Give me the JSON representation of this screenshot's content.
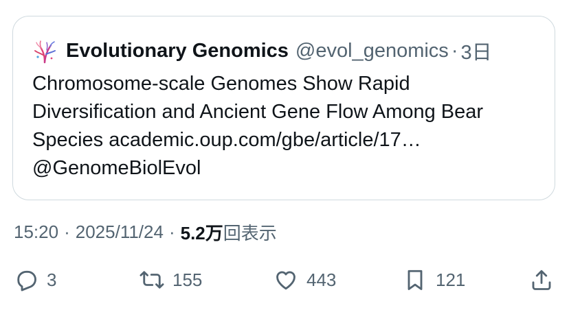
{
  "quote": {
    "display_name": "Evolutionary Genomics",
    "handle": "@evol_genomics",
    "separator": "·",
    "time_ago": "3日",
    "text_lines": [
      "Chromosome-scale Genomes Show Rapid",
      "Diversification and Ancient Gene Flow Among Bear",
      "Species academic.oup.com/gbe/article/17…",
      "@GenomeBiolEvol"
    ],
    "avatar_icon": "genome-tree-logo-icon"
  },
  "meta": {
    "time": "15:20",
    "sep": "·",
    "date": "2025/11/24",
    "sep2": "·",
    "views_count": "5.2万",
    "views_label": "回表示"
  },
  "actions": {
    "reply": {
      "icon": "reply-icon",
      "count": "3"
    },
    "repost": {
      "icon": "repost-icon",
      "count": "155"
    },
    "like": {
      "icon": "heart-icon",
      "count": "443"
    },
    "bookmark": {
      "icon": "bookmark-icon",
      "count": "121"
    },
    "share": {
      "icon": "share-icon"
    }
  },
  "colors": {
    "text_primary": "#0f1419",
    "text_secondary": "#536471",
    "border": "#cfd9de"
  }
}
